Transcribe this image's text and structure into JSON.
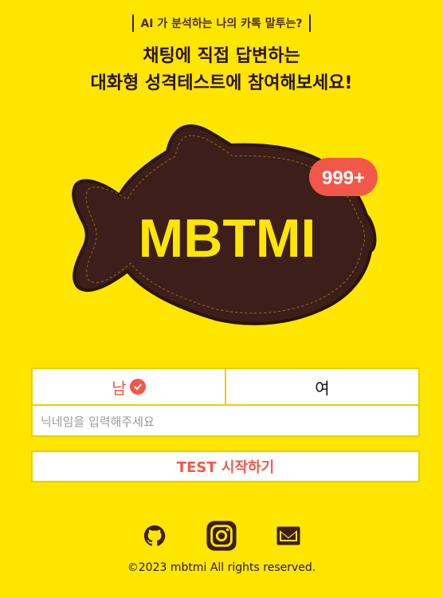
{
  "header": {
    "tagline": "AI 가 분석하는 나의 카톡 말투는?",
    "headline_line1": "채팅에 직접 답변하는",
    "headline_line2": "대화형 성격테스트에 참여해보세요!"
  },
  "hero": {
    "logo_text": "MBTMI",
    "badge_text": "999+"
  },
  "form": {
    "gender_male": "남",
    "gender_female": "여",
    "gender_selected": "남",
    "nickname_placeholder": "닉네임을 입력해주세요",
    "nickname_value": "",
    "start_label": "TEST 시작하기"
  },
  "footer": {
    "socials": [
      "github-icon",
      "instagram-icon",
      "mail-icon"
    ],
    "copyright": "©2023 mbtmi All rights reserved."
  },
  "colors": {
    "background": "#FFE600",
    "fish": "#3D1E1B",
    "accent": "#F2584A",
    "logo_text": "#FFE600"
  }
}
